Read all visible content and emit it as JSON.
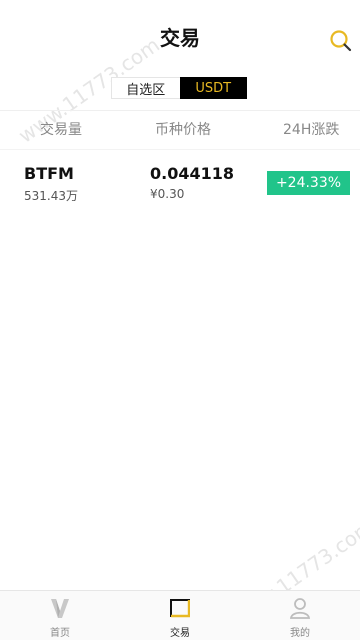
{
  "header": {
    "title": "交易",
    "search_icon": "search-icon"
  },
  "segment": {
    "tabs": [
      "自选区",
      "USDT"
    ],
    "active": "USDT"
  },
  "columns": {
    "volume": "交易量",
    "price": "币种价格",
    "change": "24H涨跌"
  },
  "rows": [
    {
      "symbol": "BTFM",
      "volume": "531.43万",
      "price": "0.044118",
      "cny": "¥0.30",
      "change": "+24.33%"
    }
  ],
  "watermark": "www.11773.com",
  "tabbar": {
    "items": [
      {
        "label": "首页",
        "icon": "home-v-icon"
      },
      {
        "label": "交易",
        "icon": "trade-icon"
      },
      {
        "label": "我的",
        "icon": "user-icon"
      }
    ]
  },
  "colors": {
    "accent": "#e8b923",
    "up": "#21c48a",
    "text": "#222222"
  }
}
